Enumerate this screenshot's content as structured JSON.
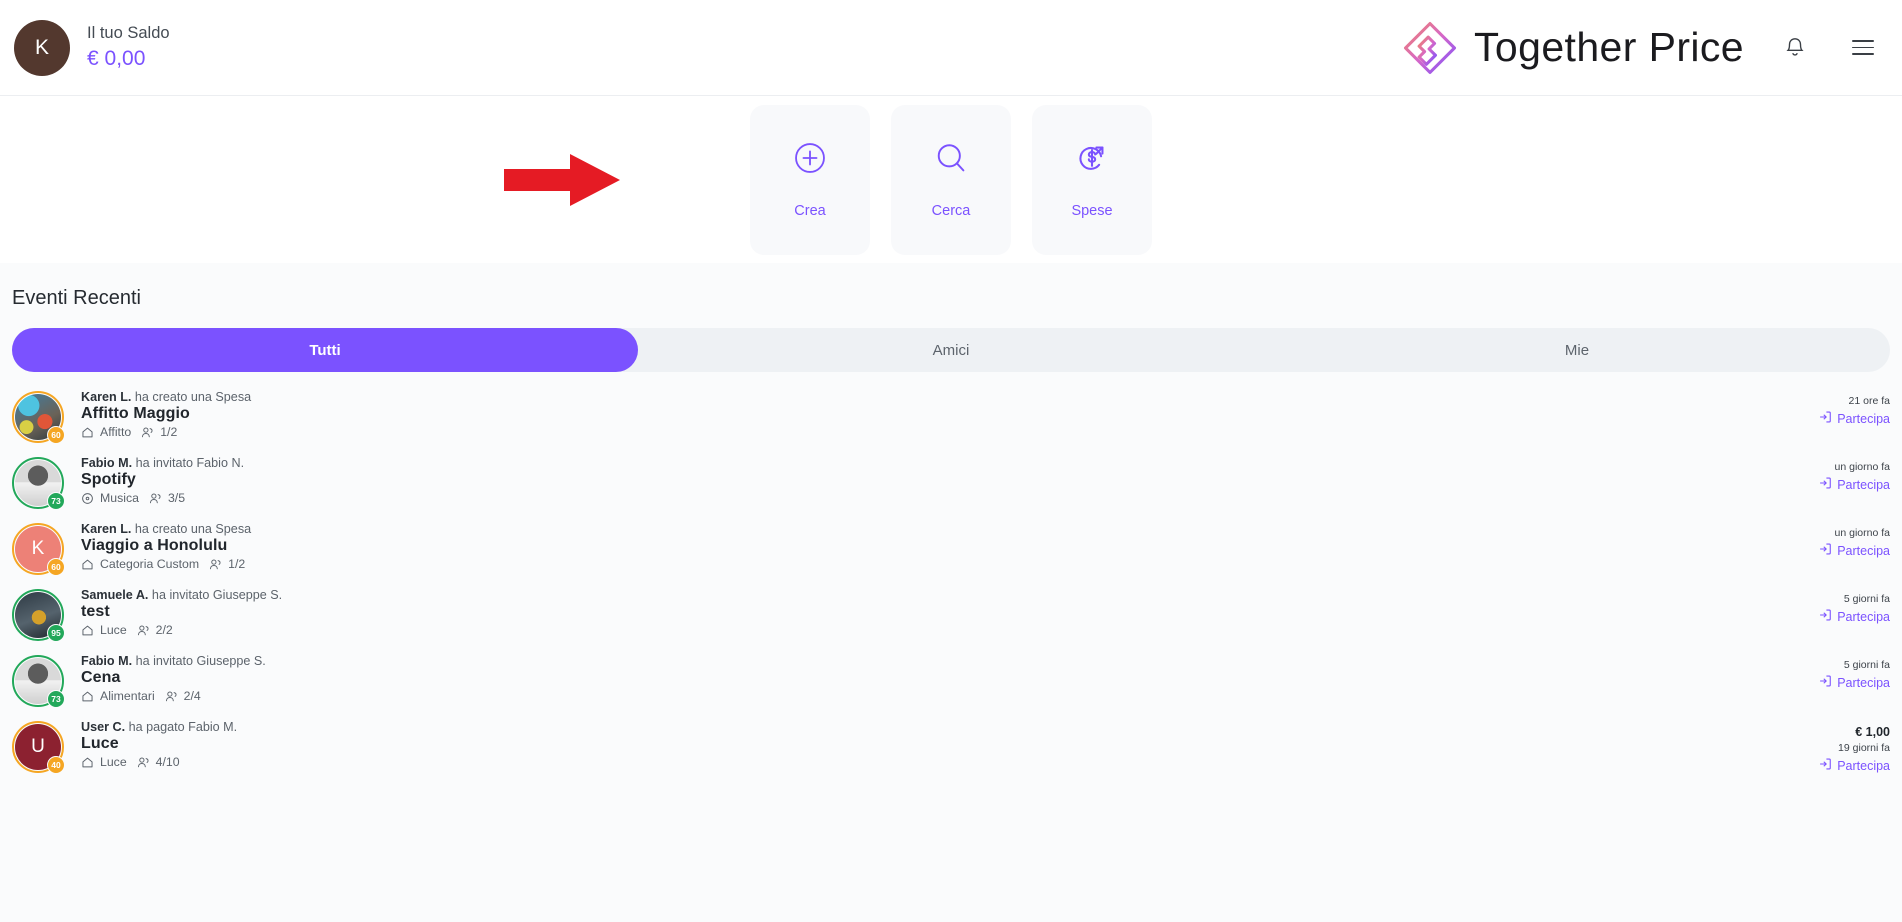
{
  "header": {
    "avatar_initial": "K",
    "balance_label": "Il tuo Saldo",
    "balance_amount": "€ 0,00",
    "brand_name": "Together Price",
    "bell_icon": "bell-icon",
    "menu_icon": "hamburger-icon",
    "accent_color": "#7b52ff",
    "avatar_color": "#53382e"
  },
  "actions": {
    "annotation_arrow_color": "#e51b24",
    "cards": [
      {
        "label": "Crea",
        "icon": "plus-circle-icon"
      },
      {
        "label": "Cerca",
        "icon": "search-icon"
      },
      {
        "label": "Spese",
        "icon": "dollar-refresh-arrow-icon"
      }
    ]
  },
  "events": {
    "title": "Eventi Recenti",
    "tabs": [
      {
        "label": "Tutti",
        "active": true
      },
      {
        "label": "Amici",
        "active": false
      },
      {
        "label": "Mie",
        "active": false
      }
    ],
    "rows": [
      {
        "actor": "Karen L.",
        "action": "ha creato una Spesa",
        "title": "Affitto Maggio",
        "category": "Affitto",
        "members": "1/2",
        "amount": "",
        "time": "21 ore fa",
        "join_label": "Partecipa",
        "ring_color": "#f5a623",
        "badge": "60",
        "badge_color": "#f5a623",
        "avatar_initial": "",
        "avatar_color": "#4f7ea8",
        "avatar_kind": "photo-art"
      },
      {
        "actor": "Fabio M.",
        "action": "ha invitato Fabio N.",
        "title": "Spotify",
        "category": "Musica",
        "members": "3/5",
        "amount": "",
        "time": "un giorno fa",
        "join_label": "Partecipa",
        "ring_color": "#22a85a",
        "badge": "73",
        "badge_color": "#22a85a",
        "avatar_initial": "",
        "avatar_color": "#8d8d8d",
        "avatar_kind": "photo-man"
      },
      {
        "actor": "Karen L.",
        "action": "ha creato una Spesa",
        "title": "Viaggio a Honolulu",
        "category": "Categoria Custom",
        "members": "1/2",
        "amount": "",
        "time": "un giorno fa",
        "join_label": "Partecipa",
        "ring_color": "#f5a623",
        "badge": "60",
        "badge_color": "#f5a623",
        "avatar_initial": "K",
        "avatar_color": "#ed8177",
        "avatar_kind": "initial"
      },
      {
        "actor": "Samuele A.",
        "action": "ha invitato Giuseppe S.",
        "title": "test",
        "category": "Luce",
        "members": "2/2",
        "amount": "",
        "time": "5 giorni fa",
        "join_label": "Partecipa",
        "ring_color": "#22a85a",
        "badge": "95",
        "badge_color": "#22a85a",
        "avatar_initial": "",
        "avatar_color": "#3e4a55",
        "avatar_kind": "photo-statue"
      },
      {
        "actor": "Fabio M.",
        "action": "ha invitato Giuseppe S.",
        "title": "Cena",
        "category": "Alimentari",
        "members": "2/4",
        "amount": "",
        "time": "5 giorni fa",
        "join_label": "Partecipa",
        "ring_color": "#22a85a",
        "badge": "73",
        "badge_color": "#22a85a",
        "avatar_initial": "",
        "avatar_color": "#8d8d8d",
        "avatar_kind": "photo-man"
      },
      {
        "actor": "User C.",
        "action": "ha pagato Fabio M.",
        "title": "Luce",
        "category": "Luce",
        "members": "4/10",
        "amount": "€ 1,00",
        "time": "19 giorni fa",
        "join_label": "Partecipa",
        "ring_color": "#f5a623",
        "badge": "40",
        "badge_color": "#f5a623",
        "avatar_initial": "U",
        "avatar_color": "#8c2130",
        "avatar_kind": "initial"
      }
    ]
  }
}
